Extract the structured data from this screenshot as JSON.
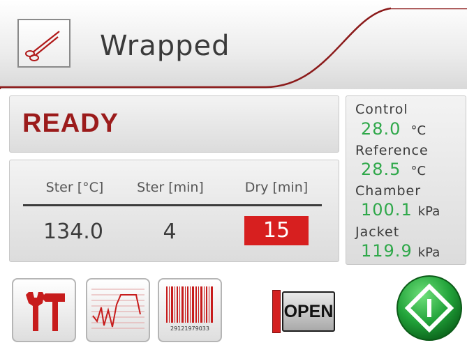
{
  "header": {
    "program_name": "Wrapped",
    "program_icon": "scissors-icon"
  },
  "status": {
    "text": "READY",
    "color": "#9b1b1b"
  },
  "parameters": {
    "headers": [
      "Ster [°C]",
      "Ster [min]",
      "Dry [min]"
    ],
    "values": [
      "134.0",
      "4",
      "15"
    ]
  },
  "sensors": {
    "control": {
      "label": "Control",
      "value": "28.0",
      "unit": "°C"
    },
    "reference": {
      "label": "Reference",
      "value": "28.5",
      "unit": "°C"
    },
    "chamber": {
      "label": "Chamber",
      "value": "100.1",
      "unit": "kPa"
    },
    "jacket": {
      "label": "Jacket",
      "value": "119.9",
      "unit": "kPa"
    }
  },
  "buttons": {
    "tools_icon": "tools-icon",
    "graph_icon": "graph-icon",
    "barcode_icon": "barcode-icon",
    "barcode_number": "29121979033",
    "door_label": "OPEN",
    "start_icon": "start-icon"
  },
  "colors": {
    "accent_red": "#d71f1f",
    "value_green": "#2fa84a",
    "start_green": "#22a33a"
  }
}
